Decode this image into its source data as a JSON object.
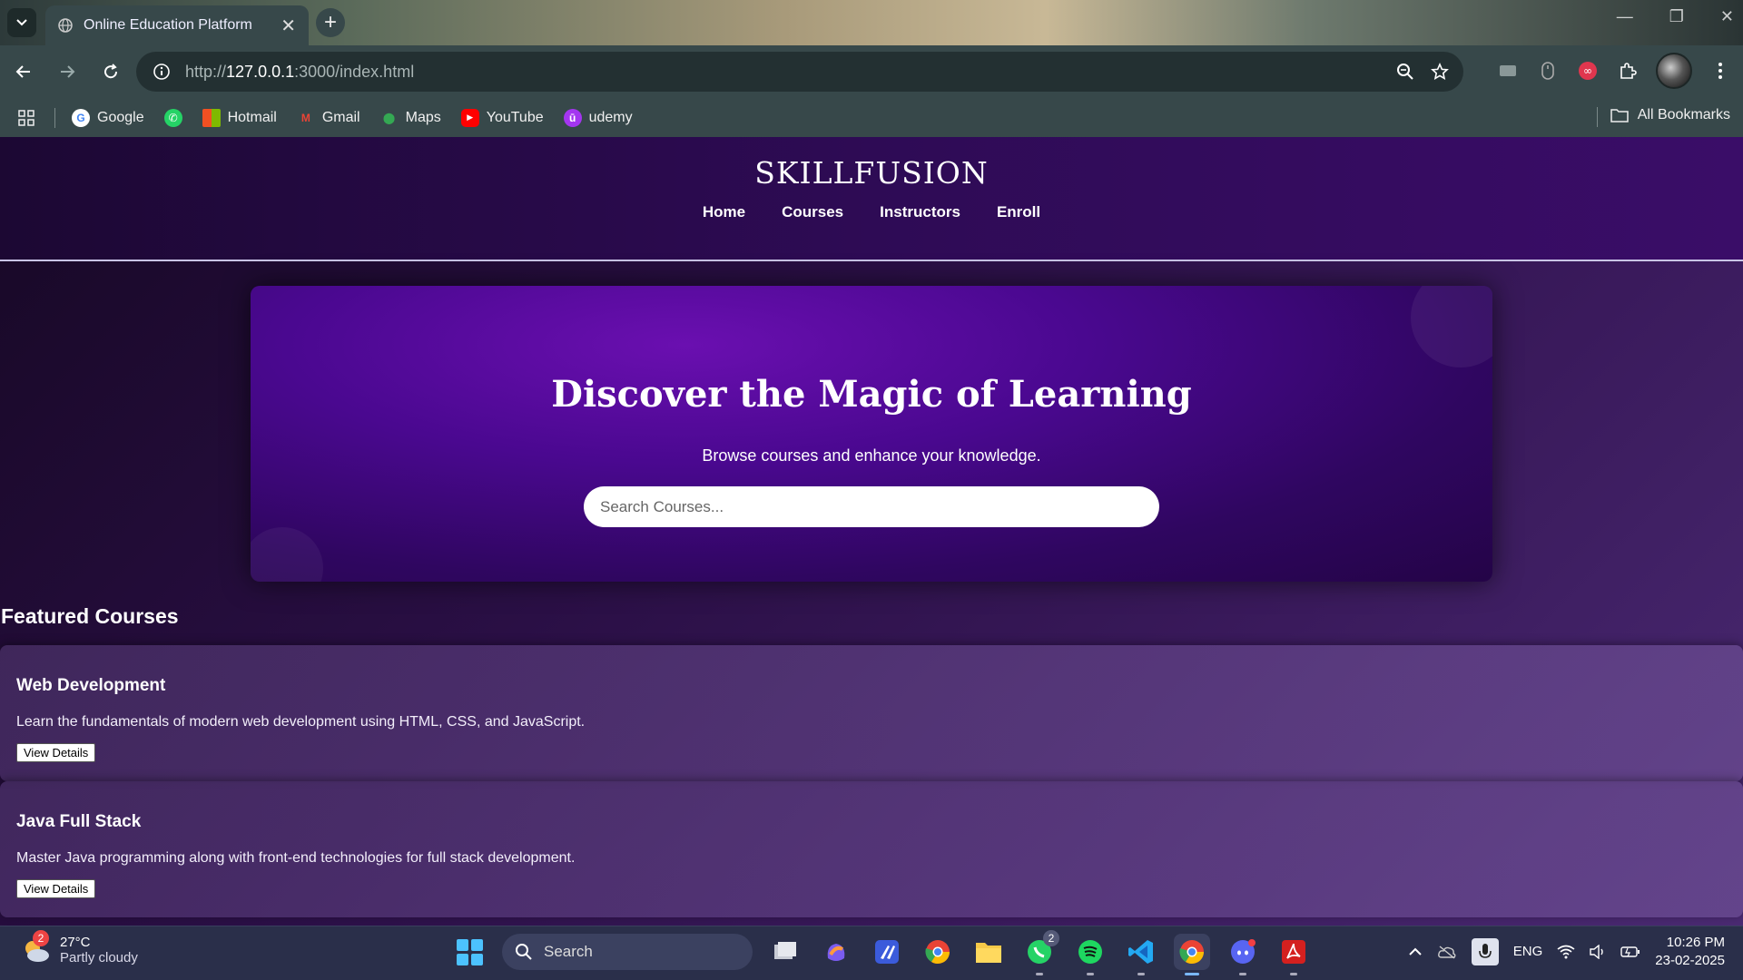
{
  "browser": {
    "tab_title": "Online Education Platform",
    "url_prefix": "http://",
    "url_host": "127.0.0.1",
    "url_rest": ":3000/index.html",
    "bookmarks": [
      {
        "label": "Google",
        "icon": "google-icon",
        "color": "#4285f4"
      },
      {
        "label": "",
        "icon": "whatsapp-icon",
        "color": "#25d366"
      },
      {
        "label": "Hotmail",
        "icon": "microsoft-icon",
        "color": "#f25022"
      },
      {
        "label": "Gmail",
        "icon": "gmail-icon",
        "color": "#ea4335"
      },
      {
        "label": "Maps",
        "icon": "maps-icon",
        "color": "#34a853"
      },
      {
        "label": "YouTube",
        "icon": "youtube-icon",
        "color": "#ff0000"
      },
      {
        "label": "udemy",
        "icon": "udemy-icon",
        "color": "#a435f0"
      }
    ],
    "all_bookmarks": "All Bookmarks"
  },
  "site": {
    "brand": "SKILLFUSION",
    "nav": [
      "Home",
      "Courses",
      "Instructors",
      "Enroll"
    ],
    "hero_title": "Discover the Magic of Learning",
    "hero_subtitle": "Browse courses and enhance your knowledge.",
    "search_placeholder": "Search Courses...",
    "featured_title": "Featured Courses",
    "courses": [
      {
        "title": "Web Development",
        "desc": "Learn the fundamentals of modern web development using HTML, CSS, and JavaScript.",
        "button": "View Details"
      },
      {
        "title": "Java Full Stack",
        "desc": "Master Java programming along with front-end technologies for full stack development.",
        "button": "View Details"
      }
    ]
  },
  "taskbar": {
    "weather_badge": "2",
    "temp": "27°C",
    "condition": "Partly cloudy",
    "search": "Search",
    "whatsapp_badge": "2",
    "lang": "ENG",
    "time": "10:26 PM",
    "date": "23-02-2025"
  },
  "colors": {
    "accent": "#4a0890",
    "header": "#2e0b55"
  }
}
